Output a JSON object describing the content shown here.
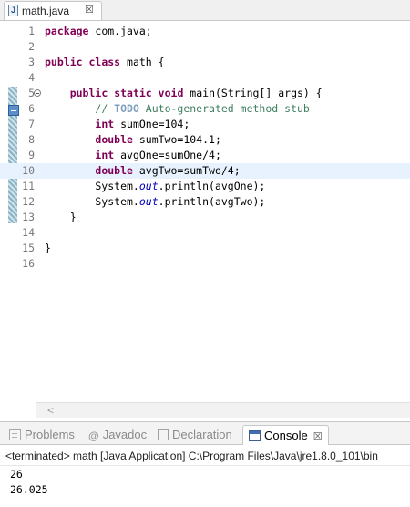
{
  "editor": {
    "tab_label": "math.java",
    "file_icon_letter": "J",
    "lines": [
      {
        "n": "1",
        "tokens": [
          {
            "t": "package",
            "c": "kw"
          },
          {
            "t": " com.java;"
          }
        ]
      },
      {
        "n": "2",
        "tokens": []
      },
      {
        "n": "3",
        "tokens": [
          {
            "t": "public",
            "c": "kw"
          },
          {
            "t": " "
          },
          {
            "t": "class",
            "c": "kw"
          },
          {
            "t": " math {"
          }
        ]
      },
      {
        "n": "4",
        "tokens": []
      },
      {
        "n": "5",
        "fold": true,
        "tokens": [
          {
            "t": "    "
          },
          {
            "t": "public",
            "c": "kw"
          },
          {
            "t": " "
          },
          {
            "t": "static",
            "c": "kw"
          },
          {
            "t": " "
          },
          {
            "t": "void",
            "c": "kw"
          },
          {
            "t": " main(String[] args) {"
          }
        ]
      },
      {
        "n": "6",
        "tokens": [
          {
            "t": "        "
          },
          {
            "t": "// ",
            "c": "cm"
          },
          {
            "t": "TODO",
            "c": "task"
          },
          {
            "t": " Auto-generated method stub",
            "c": "cm"
          }
        ]
      },
      {
        "n": "7",
        "tokens": [
          {
            "t": "        "
          },
          {
            "t": "int",
            "c": "kw"
          },
          {
            "t": " sumOne=104;"
          }
        ]
      },
      {
        "n": "8",
        "tokens": [
          {
            "t": "        "
          },
          {
            "t": "double",
            "c": "kw"
          },
          {
            "t": " sumTwo=104.1;"
          }
        ]
      },
      {
        "n": "9",
        "tokens": [
          {
            "t": "        "
          },
          {
            "t": "int",
            "c": "kw"
          },
          {
            "t": " avgOne=sumOne/4;"
          }
        ]
      },
      {
        "n": "10",
        "current": true,
        "tokens": [
          {
            "t": "        "
          },
          {
            "t": "double",
            "c": "kw"
          },
          {
            "t": " avgTwo=sumTwo/4;"
          }
        ]
      },
      {
        "n": "11",
        "tokens": [
          {
            "t": "        System."
          },
          {
            "t": "out",
            "c": "fld"
          },
          {
            "t": ".println(avgOne);"
          }
        ]
      },
      {
        "n": "12",
        "tokens": [
          {
            "t": "        System."
          },
          {
            "t": "out",
            "c": "fld"
          },
          {
            "t": ".println(avgTwo);"
          }
        ]
      },
      {
        "n": "13",
        "tokens": [
          {
            "t": "    }"
          }
        ]
      },
      {
        "n": "14",
        "tokens": []
      },
      {
        "n": "15",
        "tokens": [
          {
            "t": "}"
          }
        ]
      },
      {
        "n": "16",
        "tokens": []
      }
    ]
  },
  "views": {
    "tabs": [
      {
        "label": "Problems",
        "icon": "problems-icon"
      },
      {
        "label": "Javadoc",
        "icon": "javadoc-icon",
        "glyph": "@"
      },
      {
        "label": "Declaration",
        "icon": "declaration-icon"
      },
      {
        "label": "Console",
        "icon": "console-icon",
        "active": true
      }
    ],
    "close_glyph": "☒"
  },
  "console": {
    "status": "<terminated> math [Java Application] C:\\Program Files\\Java\\jre1.8.0_101\\bin",
    "output": [
      "26",
      "26.025"
    ]
  },
  "colors": {
    "keyword": "#7f0055",
    "comment": "#3f7f5f",
    "task_tag": "#7f9fbf",
    "static_field": "#0000c0",
    "current_line": "#e8f2fe"
  }
}
